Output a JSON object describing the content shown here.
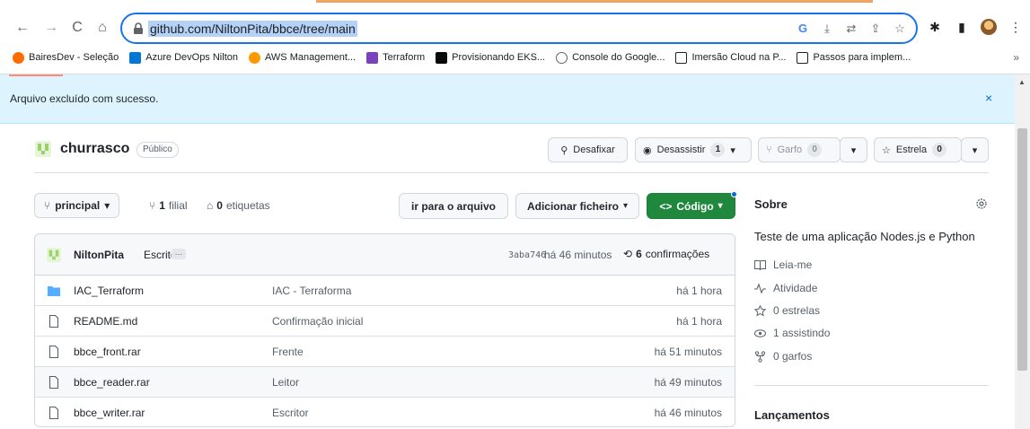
{
  "browser": {
    "url": "github.com/NiltonPita/bbce/tree/main",
    "bookmarks": [
      {
        "label": "BairesDev - Seleção",
        "color": "#ff6b00"
      },
      {
        "label": "Azure DevOps Nilton",
        "color": "#0078d4"
      },
      {
        "label": "AWS Management...",
        "color": "#ff9900"
      },
      {
        "label": "Terraform",
        "color": "#7b42bc"
      },
      {
        "label": "Provisionando EKS...",
        "color": "#0a0a0a"
      },
      {
        "label": "Console do Google...",
        "color": "#5f6368"
      },
      {
        "label": "Imersão Cloud na P...",
        "color": "#202124"
      },
      {
        "label": "Passos para implem...",
        "color": "#202124"
      }
    ],
    "more": "»"
  },
  "flash": {
    "message": "Arquivo excluído com sucesso.",
    "close": "×"
  },
  "repo": {
    "name": "churrasco",
    "visibility": "Público",
    "unpin_label": "Desafixar",
    "watch_label": "Desassistir",
    "watch_count": "1",
    "fork_label": "Garfo",
    "fork_count": "0",
    "star_label": "Estrela",
    "star_count": "0"
  },
  "filenav": {
    "branch": "principal",
    "branches_count": "1",
    "branches_label": "filial",
    "tags_count": "0",
    "tags_label": "etiquetas",
    "goto_file": "ir para o arquivo",
    "add_file": "Adicionar ficheiro",
    "code": "Código"
  },
  "commit": {
    "author": "NiltonPita",
    "message": "Escritor",
    "ellipsis": "…",
    "sha": "3aba746",
    "time": "há 46 minutos",
    "count": "6",
    "count_label": "confirmações"
  },
  "files": [
    {
      "name": "IAC_Terraform",
      "type": "folder",
      "message": "IAC - Terraforma",
      "time": "há 1 hora"
    },
    {
      "name": "README.md",
      "type": "file",
      "message": "Confirmação inicial",
      "time": "há 1 hora"
    },
    {
      "name": "bbce_front.rar",
      "type": "file",
      "message": "Frente",
      "time": "há 51 minutos"
    },
    {
      "name": "bbce_reader.rar",
      "type": "file",
      "message": "Leitor",
      "time": "há 49 minutos"
    },
    {
      "name": "bbce_writer.rar",
      "type": "file",
      "message": "Escritor",
      "time": "há 46 minutos"
    }
  ],
  "sidebar": {
    "title": "Sobre",
    "description": "Teste de uma aplicação Nodes.js e Python",
    "readme": "Leia-me",
    "activity": "Atividade",
    "stars": "0 estrelas",
    "watching": "1 assistindo",
    "forks": "0 garfos",
    "releases": "Lançamentos"
  },
  "colors": {
    "accent": "#1f883d",
    "link": "#0969da",
    "flash_bg": "#ddf4ff"
  }
}
